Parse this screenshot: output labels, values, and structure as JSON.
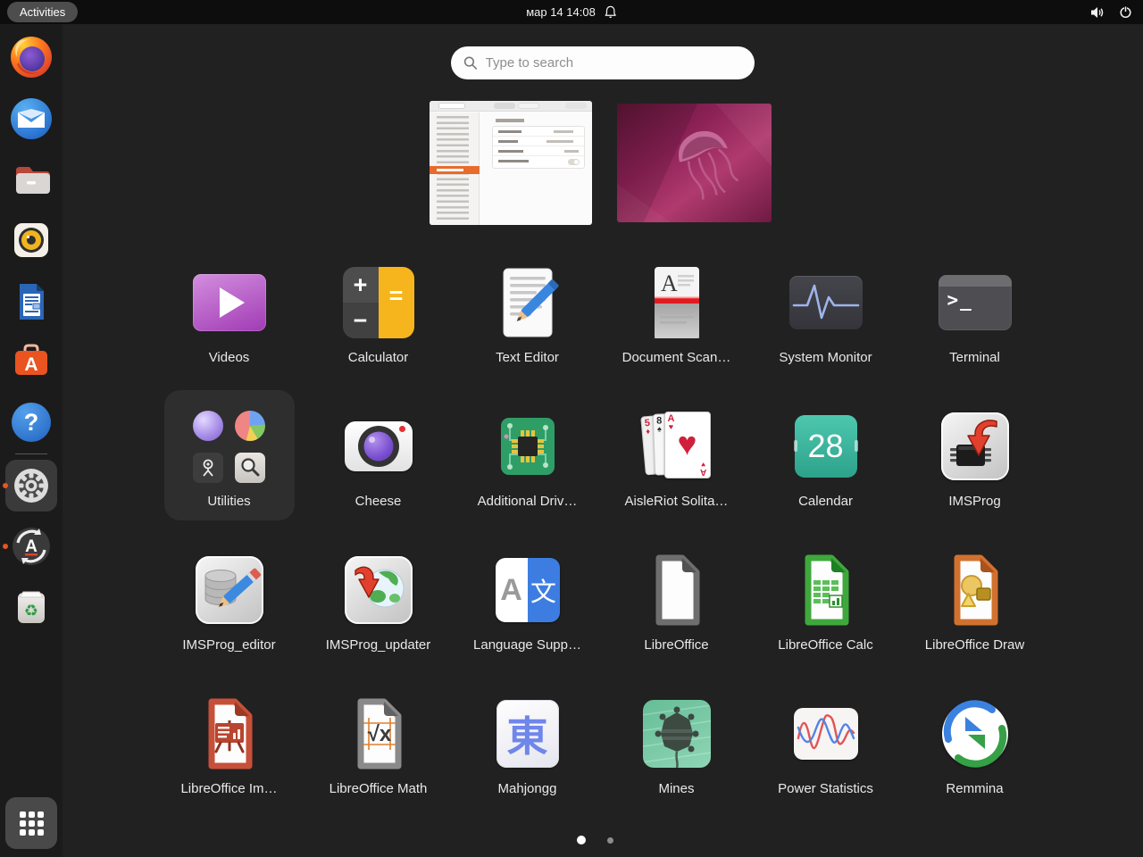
{
  "topbar": {
    "activities_label": "Activities",
    "clock": "мар 14 14:08"
  },
  "search": {
    "placeholder": "Type to search"
  },
  "dock": {
    "items": [
      {
        "name": "firefox"
      },
      {
        "name": "thunderbird"
      },
      {
        "name": "files"
      },
      {
        "name": "rhythmbox"
      },
      {
        "name": "libreoffice-writer"
      },
      {
        "name": "ubuntu-software",
        "glyph": "A"
      },
      {
        "name": "help",
        "glyph": "?"
      },
      {
        "name": "settings",
        "running": true,
        "active": true
      },
      {
        "name": "software-updater",
        "glyph": "A",
        "running": true
      },
      {
        "name": "trash",
        "glyph": "♻"
      },
      {
        "name": "show-applications",
        "active": true
      }
    ]
  },
  "previews": [
    {
      "name": "settings-window"
    },
    {
      "name": "desktop-wallpaper"
    }
  ],
  "apps": [
    {
      "label": "Videos"
    },
    {
      "label": "Calculator",
      "plus": "+",
      "minus": "−",
      "equals": "="
    },
    {
      "label": "Text Editor"
    },
    {
      "label": "Document Scan…",
      "letter": "A"
    },
    {
      "label": "System Monitor"
    },
    {
      "label": "Terminal",
      "prompt": ">_"
    },
    {
      "label": "Utilities"
    },
    {
      "label": "Cheese"
    },
    {
      "label": "Additional Driv…"
    },
    {
      "label": "AisleRiot Solita…",
      "corners": [
        "5",
        "8",
        "A"
      ],
      "suits": [
        "♦",
        "♠",
        "♥"
      ]
    },
    {
      "label": "Calendar",
      "day": "28"
    },
    {
      "label": "IMSProg"
    },
    {
      "label": "IMSProg_editor"
    },
    {
      "label": "IMSProg_updater"
    },
    {
      "label": "Language Supp…",
      "latin": "A",
      "cjk": "文"
    },
    {
      "label": "LibreOffice"
    },
    {
      "label": "LibreOffice Calc"
    },
    {
      "label": "LibreOffice Draw"
    },
    {
      "label": "LibreOffice Im…"
    },
    {
      "label": "LibreOffice Math",
      "formula": "√x"
    },
    {
      "label": "Mahjongg",
      "glyph": "東"
    },
    {
      "label": "Mines"
    },
    {
      "label": "Power Statistics"
    },
    {
      "label": "Remmina"
    }
  ],
  "pager": {
    "page_count": 2,
    "active_page": 1
  }
}
